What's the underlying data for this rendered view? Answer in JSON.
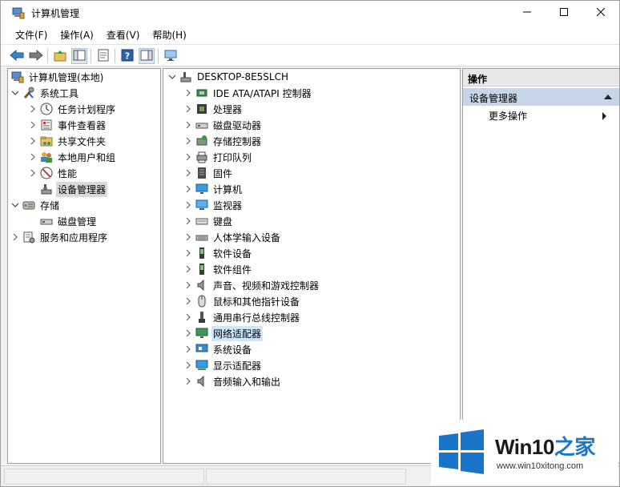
{
  "window": {
    "title": "计算机管理",
    "minimize_icon": "minimize-icon",
    "maximize_icon": "maximize-icon",
    "close_icon": "close-icon"
  },
  "menu": {
    "items": [
      "文件(F)",
      "操作(A)",
      "查看(V)",
      "帮助(H)"
    ]
  },
  "toolbar": {
    "icons": [
      "back-arrow-icon",
      "forward-arrow-icon",
      "up-folder-icon",
      "show-hide-tree-icon",
      "properties-icon",
      "help-icon",
      "show-action-pane-icon",
      "monitor-icon"
    ]
  },
  "left_tree": {
    "root": "计算机管理(本地)",
    "system_tools": "系统工具",
    "task_scheduler": "任务计划程序",
    "event_viewer": "事件查看器",
    "shared_folders": "共享文件夹",
    "local_users": "本地用户和组",
    "performance": "性能",
    "device_manager": "设备管理器",
    "storage": "存储",
    "disk_management": "磁盘管理",
    "services": "服务和应用程序"
  },
  "device_tree": {
    "computer": "DESKTOP-8E5SLCH",
    "categories": [
      "IDE ATA/ATAPI 控制器",
      "处理器",
      "磁盘驱动器",
      "存储控制器",
      "打印队列",
      "固件",
      "计算机",
      "监视器",
      "键盘",
      "人体学输入设备",
      "软件设备",
      "软件组件",
      "声音、视频和游戏控制器",
      "鼠标和其他指针设备",
      "通用串行总线控制器",
      "网络适配器",
      "系统设备",
      "显示适配器",
      "音频输入和输出"
    ],
    "selected": "网络适配器"
  },
  "actions": {
    "header": "操作",
    "section": "设备管理器",
    "more": "更多操作"
  },
  "watermark": {
    "brand_prefix": "Win10",
    "brand_suffix": "之家",
    "url": "www.win10xitong.com",
    "colors": {
      "blue": "#1a74c8",
      "dark": "#1a1a1a"
    }
  }
}
